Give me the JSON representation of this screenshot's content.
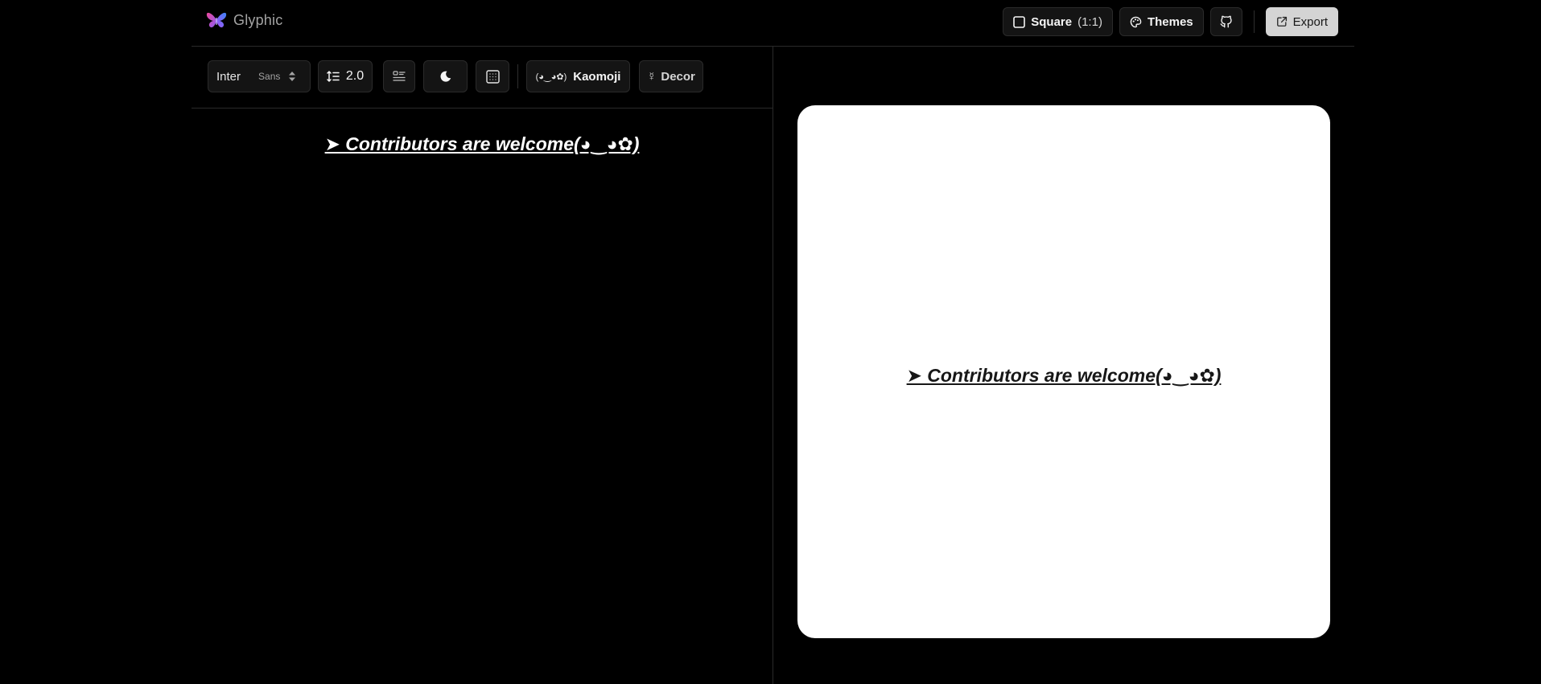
{
  "brand": {
    "name": "Glyphic",
    "logo_icon": "butterfly-icon"
  },
  "header": {
    "aspect_button": {
      "label": "Square",
      "ratio": "(1:1)",
      "icon": "square-icon"
    },
    "themes_button": {
      "label": "Themes",
      "icon": "palette-icon"
    },
    "github_button": {
      "icon": "github-icon"
    },
    "export_button": {
      "label": "Export",
      "icon": "export-icon"
    }
  },
  "toolbar": {
    "font_select": {
      "font": "Inter",
      "category": "Sans"
    },
    "line_height": {
      "value": "2.0",
      "icon": "line-height-icon"
    },
    "align_button": {
      "icon": "text-align-icon"
    },
    "theme_toggle": {
      "icon": "moon-icon"
    },
    "grid_button": {
      "icon": "grid-icon"
    },
    "kaomoji_button": {
      "face": "(◕‿◕✿)",
      "label": "Kaomoji"
    },
    "decor_button": {
      "glyph": "☿",
      "label": "Decor"
    }
  },
  "editor": {
    "text": "➤ Contributors are welcome(◕‿◕✿)"
  },
  "preview": {
    "text": "➤ Contributors are welcome(◕‿◕✿)",
    "background": "#ffffff",
    "text_color": "#171717"
  },
  "colors": {
    "app_background": "#000000",
    "border": "#2a2a2a",
    "button_background": "#141414",
    "export_background": "#d4d4d4"
  }
}
